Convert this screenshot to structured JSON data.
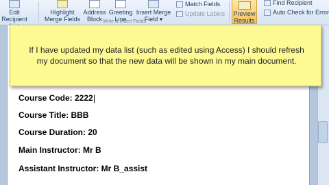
{
  "ribbon": {
    "edit_recipient_list": [
      "Edit",
      "Recipient List"
    ],
    "highlight_merge_fields": [
      "Highlight",
      "Merge Fields"
    ],
    "address_block": [
      "Address",
      "Block"
    ],
    "greeting_line": [
      "Greeting",
      "Line"
    ],
    "insert_merge_field": [
      "Insert Merge",
      "Field ▾"
    ],
    "match_fields": "Match Fields",
    "update_labels": "Update Labels",
    "preview_results": [
      "Preview",
      "Results"
    ],
    "find_recipient": "Find Recipient",
    "auto_check_errors": "Auto Check for Errors",
    "group_label_write_insert": "Write & Insert Fields"
  },
  "callout": {
    "text": "If I have updated my data list (such as edited using Access) I should refresh my document so that the new data will be shown in my main document."
  },
  "document": {
    "course_code": "Course Code: 2222",
    "course_title": "Course Title: BBB",
    "course_duration": "Course Duration: 20",
    "main_instructor": "Main Instructor: Mr B",
    "assistant_instructor": "Assistant Instructor: Mr B_assist"
  }
}
